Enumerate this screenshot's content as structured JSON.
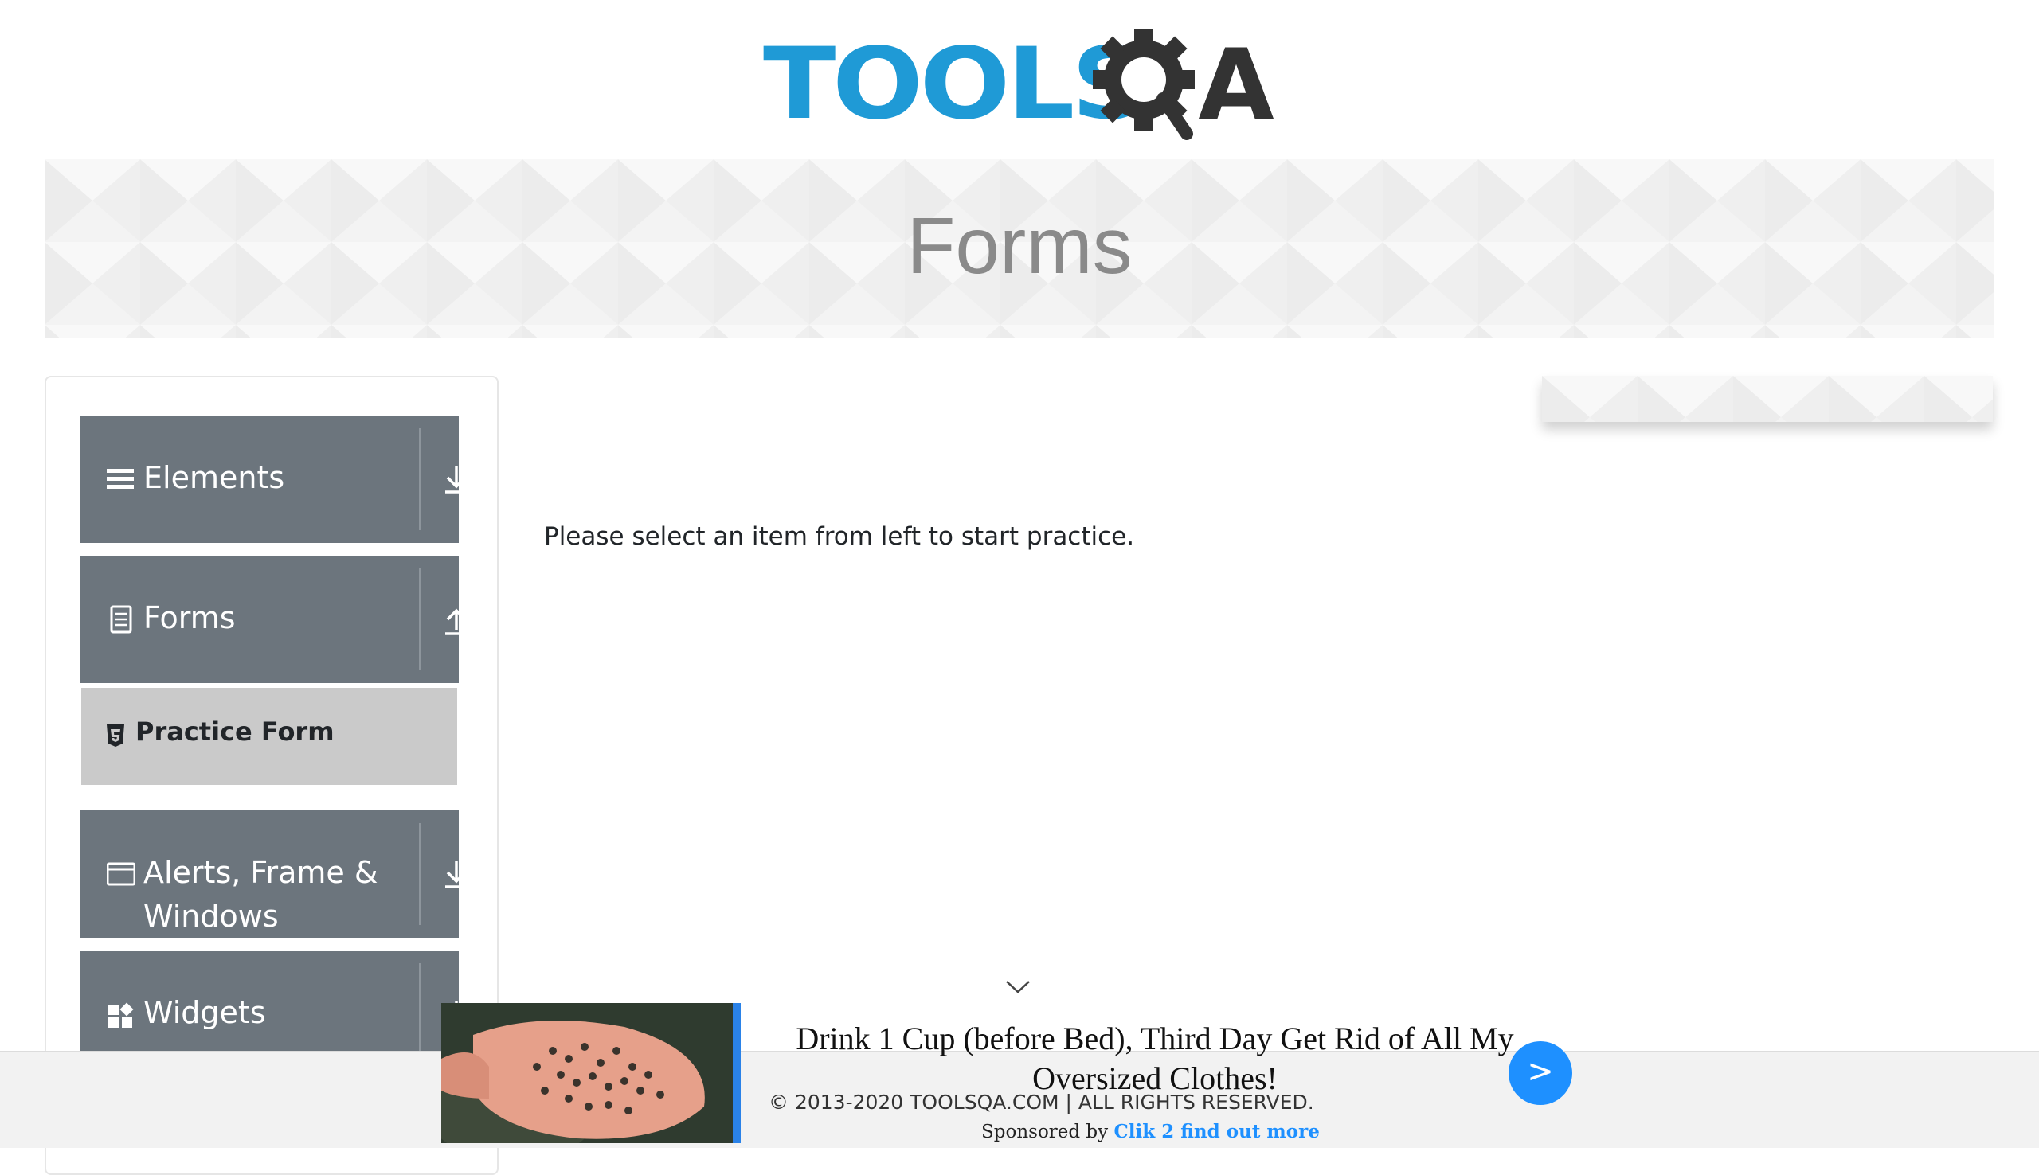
{
  "header": {
    "logo_text": "TOOLS",
    "logo_letter": "A"
  },
  "banner": {
    "title": "Forms"
  },
  "sidebar": {
    "groups": [
      {
        "label": "Elements",
        "icon": "hamburger-icon",
        "arrow": "expand"
      },
      {
        "label": "Forms",
        "icon": "document-icon",
        "arrow": "collapse"
      },
      {
        "label_line1": "Alerts, Frame &",
        "label_line2": "Windows",
        "icon": "window-icon",
        "arrow": "expand"
      },
      {
        "label": "Widgets",
        "icon": "widgets-icon",
        "arrow": "expand"
      }
    ],
    "forms_items": [
      {
        "label": "Practice Form",
        "icon": "html5-icon"
      }
    ]
  },
  "main": {
    "message": "Please select an item from left to start practice."
  },
  "footer": {
    "copyright": "© 2013-2020 TOOLSQA.COM | ALL RIGHTS RESERVED."
  },
  "ad": {
    "headline_line1": "Drink 1 Cup (before Bed), Third Day Get Rid of All My",
    "headline_line2": "Oversized Clothes!",
    "sponsored_prefix": "Sponsored by",
    "sponsor_name": "Clik 2 find out more",
    "next_label": ">"
  },
  "colors": {
    "accent": "#1f9ad6",
    "sidebar_header": "#6c757d",
    "active_item": "#cacaca",
    "ad_button": "#1e90ff"
  }
}
